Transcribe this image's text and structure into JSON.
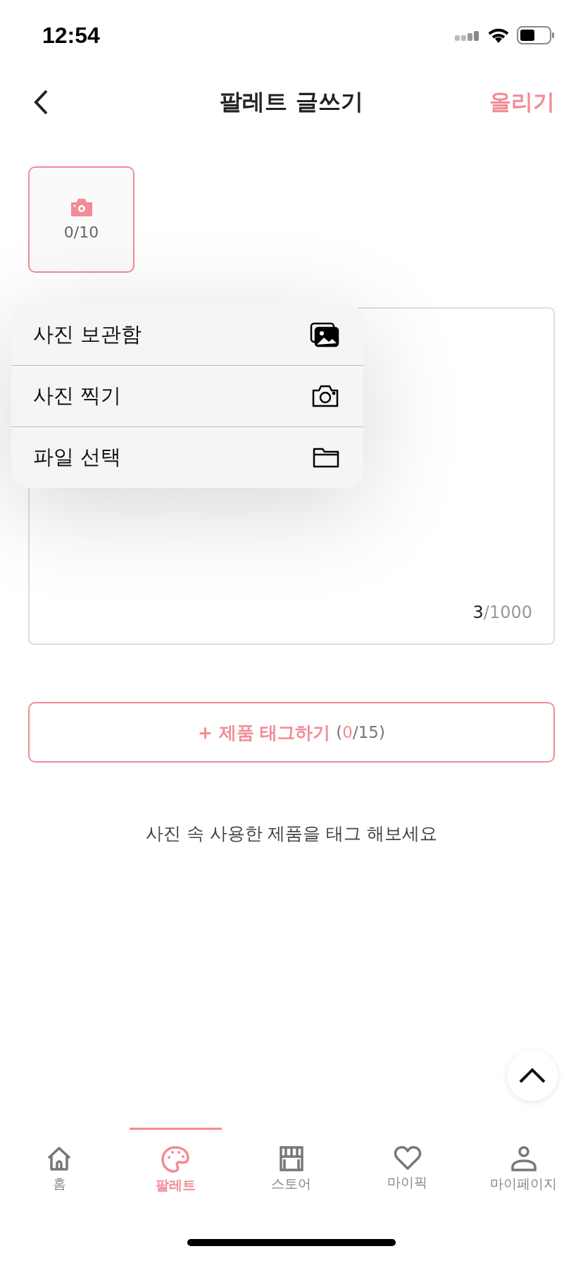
{
  "status_bar": {
    "time": "12:54"
  },
  "header": {
    "title": "팔레트 글쓰기",
    "action": "올리기"
  },
  "photo_picker": {
    "count": "0/10"
  },
  "menu": {
    "items": [
      {
        "label": "사진 보관함",
        "kind": "gallery"
      },
      {
        "label": "사진 찍기",
        "kind": "camera"
      },
      {
        "label": "파일 선택",
        "kind": "folder"
      }
    ]
  },
  "text_area": {
    "counter": {
      "current": "3",
      "limit": "/1000"
    }
  },
  "tag_button": {
    "label": "+ 제품 태그하기",
    "counter": {
      "open": "(",
      "current": "0",
      "rest": "/15)"
    }
  },
  "hint": "사진 속 사용한 제품을 태그 해보세요",
  "tabs": [
    {
      "label": "홈",
      "kind": "home",
      "selected": false
    },
    {
      "label": "팔레트",
      "kind": "palette",
      "selected": true
    },
    {
      "label": "스토어",
      "kind": "store",
      "selected": false
    },
    {
      "label": "마이픽",
      "kind": "heart",
      "selected": false
    },
    {
      "label": "마이페이지",
      "kind": "person",
      "selected": false
    }
  ]
}
